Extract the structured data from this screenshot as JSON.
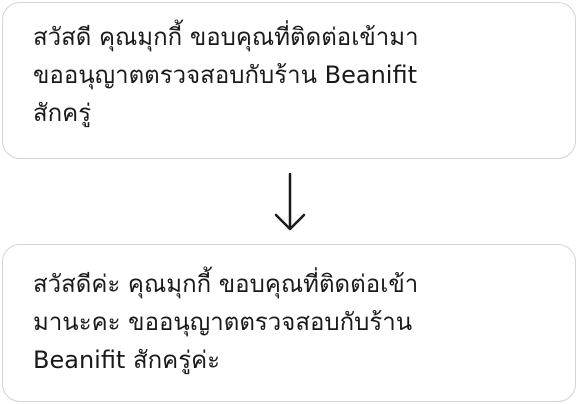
{
  "original_message": {
    "lines": [
      "สวัสดี คุณมุกกี้ ขอบคุณที่ติดต่อเข้ามา",
      "ขออนุญาตตรวจสอบกับร้าน Beanifit",
      "สักครู่"
    ]
  },
  "revised_message": {
    "lines": [
      "สวัสดีค่ะ คุณมุกกี้ ขอบคุณที่ติดต่อเข้า",
      "มานะคะ ขออนุญาตตรวจสอบกับร้าน",
      "Beanifit สักครู่ค่ะ"
    ]
  },
  "arrow_icon": "arrow-down-icon"
}
